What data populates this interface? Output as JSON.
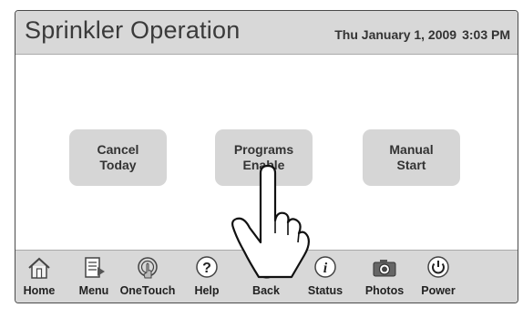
{
  "header": {
    "title": "Sprinkler Operation",
    "date": "Thu January 1, 2009",
    "time": "3:03 PM"
  },
  "buttons": {
    "cancel_today": "Cancel\nToday",
    "programs_enable": "Programs\nEnable",
    "manual_start": "Manual\nStart"
  },
  "nav": {
    "items": [
      {
        "label": "Home",
        "icon": "home-icon"
      },
      {
        "label": "Menu",
        "icon": "menu-icon"
      },
      {
        "label": "OneTouch",
        "icon": "onetouch-icon"
      },
      {
        "label": "Help",
        "icon": "help-icon"
      },
      {
        "label": "Back",
        "icon": "back-icon"
      },
      {
        "label": "Status",
        "icon": "status-icon"
      },
      {
        "label": "Photos",
        "icon": "camera-icon"
      },
      {
        "label": "Power",
        "icon": "power-icon"
      }
    ]
  }
}
